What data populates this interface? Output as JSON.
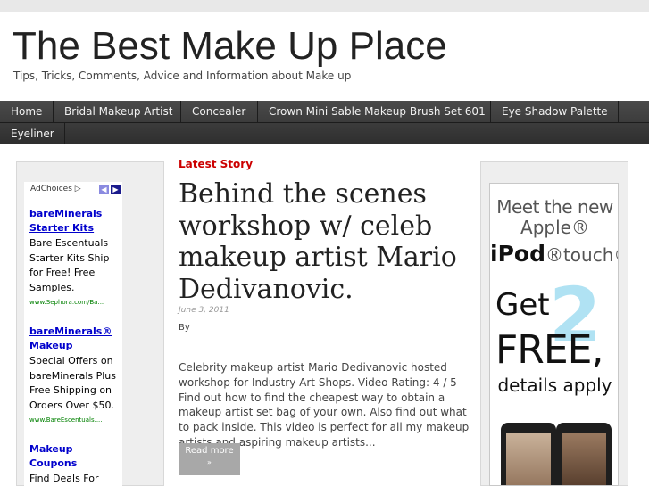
{
  "site": {
    "title": "The Best Make Up Place",
    "tagline": "Tips, Tricks, Comments, Advice and Information about Make up"
  },
  "nav": {
    "items": [
      {
        "label": "Home"
      },
      {
        "label": "Bridal Makeup Artist"
      },
      {
        "label": "Concealer"
      },
      {
        "label": "Crown Mini Sable Makeup Brush Set 601"
      },
      {
        "label": "Eye Shadow Palette"
      },
      {
        "label": "Eyeliner"
      }
    ]
  },
  "left_ad": {
    "adchoices_label": "AdChoices",
    "prev_icon": "chevron-left-icon",
    "next_icon": "chevron-right-icon",
    "ads": [
      {
        "title": "bareMinerals Starter Kits",
        "description": "Bare Escentuals Starter Kits Ship for Free! Free Samples.",
        "url": "www.Sephora.com/Ba..."
      },
      {
        "title": "bareMinerals® Makeup",
        "description": "Special Offers on bareMinerals Plus Free Shipping on Orders Over $50.",
        "url": "www.BareEscentuals...."
      },
      {
        "title": "Makeup Coupons",
        "description": "Find Deals For Your Favorite Twin",
        "url": ""
      }
    ]
  },
  "main": {
    "section_label": "Latest Story",
    "post": {
      "title": "Behind the scenes workshop w/ celeb makeup artist Mario Dedivanovic.",
      "date": "June 3, 2011",
      "byline": "By",
      "excerpt": "Celebrity makeup artist Mario Dedivanovic hosted workshop for Industry Art Shops. Video Rating: 4 / 5 Find out how to find the cheapest way to obtain a makeup artist set bag of your own. Also find out what to pack inside. This video is perfect for all my makeup artists and aspiring makeup artists...",
      "read_more_label": "Read more",
      "read_more_icon": "chevron-down-icon"
    }
  },
  "right_ad": {
    "line1": "Meet the new",
    "line2": "Apple®",
    "ipod_bold": "iPod",
    "ipod_light": "®touch®",
    "get": "Get",
    "number": "2",
    "free": "FREE,",
    "details": "details apply",
    "colors": {
      "number": "#8fd7ee"
    }
  },
  "colors": {
    "nav_background": "#3a3a3a",
    "accent": "#cc0000",
    "ad_link": "#0000cc",
    "ad_url": "#008000"
  }
}
